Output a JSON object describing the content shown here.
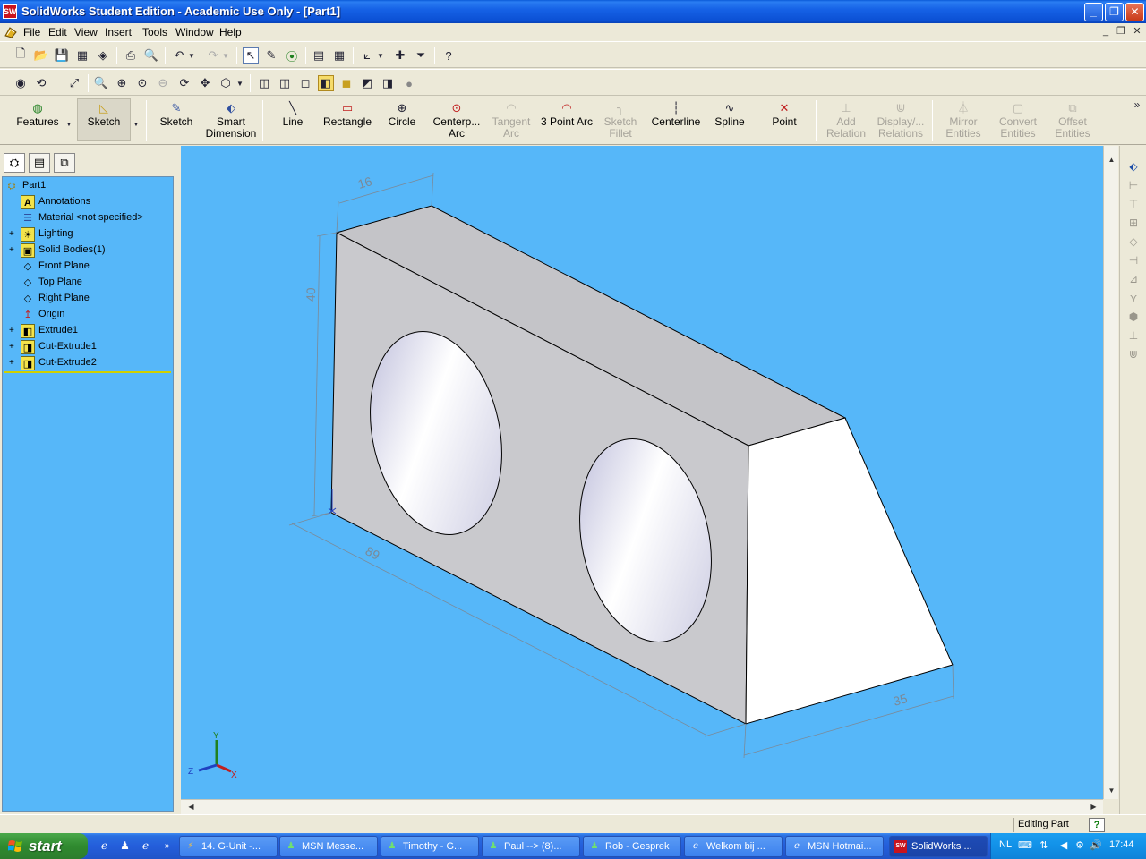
{
  "window": {
    "title": "SolidWorks Student Edition - Academic Use Only - [Part1]",
    "app_icon_text": "SW",
    "caption_buttons": [
      "_",
      "❐",
      "✕"
    ]
  },
  "menubar": {
    "items": [
      "File",
      "Edit",
      "View",
      "Insert",
      "Tools",
      "Window",
      "Help"
    ]
  },
  "command_manager": {
    "tabs": [
      "Features",
      "Sketch"
    ],
    "active_tab": "Sketch",
    "commands": [
      {
        "label1": "Sketch",
        "label2": "",
        "enabled": true
      },
      {
        "label1": "Smart",
        "label2": "Dimension",
        "enabled": true
      },
      {
        "label1": "Line",
        "label2": "",
        "enabled": true
      },
      {
        "label1": "Rectangle",
        "label2": "",
        "enabled": true
      },
      {
        "label1": "Circle",
        "label2": "",
        "enabled": true
      },
      {
        "label1": "Centerp...",
        "label2": "Arc",
        "enabled": true
      },
      {
        "label1": "Tangent",
        "label2": "Arc",
        "enabled": false
      },
      {
        "label1": "3 Point Arc",
        "label2": "",
        "enabled": true
      },
      {
        "label1": "Sketch",
        "label2": "Fillet",
        "enabled": false
      },
      {
        "label1": "Centerline",
        "label2": "",
        "enabled": true
      },
      {
        "label1": "Spline",
        "label2": "",
        "enabled": true
      },
      {
        "label1": "Point",
        "label2": "",
        "enabled": true
      },
      {
        "label1": "Add",
        "label2": "Relation",
        "enabled": false
      },
      {
        "label1": "Display/...",
        "label2": "Relations",
        "enabled": false
      },
      {
        "label1": "Mirror",
        "label2": "Entities",
        "enabled": false
      },
      {
        "label1": "Convert",
        "label2": "Entities",
        "enabled": false
      },
      {
        "label1": "Offset",
        "label2": "Entities",
        "enabled": false
      }
    ],
    "overflow": "»"
  },
  "feature_tree": {
    "items": [
      {
        "label": "Part1",
        "expandable": false,
        "icon": "part-icon"
      },
      {
        "label": "Annotations",
        "expandable": false,
        "icon": "annotations-icon"
      },
      {
        "label": "Material <not specified>",
        "expandable": false,
        "icon": "material-icon"
      },
      {
        "label": "Lighting",
        "expandable": true,
        "icon": "lighting-icon"
      },
      {
        "label": "Solid Bodies(1)",
        "expandable": true,
        "icon": "solid-bodies-icon"
      },
      {
        "label": "Front Plane",
        "expandable": false,
        "icon": "plane-icon"
      },
      {
        "label": "Top Plane",
        "expandable": false,
        "icon": "plane-icon"
      },
      {
        "label": "Right Plane",
        "expandable": false,
        "icon": "plane-icon"
      },
      {
        "label": "Origin",
        "expandable": false,
        "icon": "origin-icon"
      },
      {
        "label": "Extrude1",
        "expandable": true,
        "icon": "extrude-icon"
      },
      {
        "label": "Cut-Extrude1",
        "expandable": true,
        "icon": "cut-extrude-icon"
      },
      {
        "label": "Cut-Extrude2",
        "expandable": true,
        "icon": "cut-extrude-icon"
      }
    ]
  },
  "model": {
    "dimensions": {
      "top": "16",
      "left": "40",
      "bottom": "89",
      "right": "35"
    },
    "triad": {
      "x": "X",
      "y": "Y",
      "z": "Z"
    },
    "colors": {
      "background": "#56b7f9",
      "face": "#c8c8cc",
      "top_face": "#c4c4c8",
      "side_face": "#ffffff",
      "dimension": "#7a8a99"
    }
  },
  "status": {
    "mode": "Editing Part",
    "help": "?"
  },
  "taskbar": {
    "start_label": "start",
    "tasks": [
      {
        "label": "14. G-Unit -...",
        "active": false
      },
      {
        "label": "MSN Messe...",
        "active": false
      },
      {
        "label": "Timothy - G...",
        "active": false
      },
      {
        "label": "Paul --> (8)...",
        "active": false
      },
      {
        "label": "Rob - Gesprek",
        "active": false
      },
      {
        "label": "Welkom bij ...",
        "active": false
      },
      {
        "label": "MSN Hotmai...",
        "active": false
      },
      {
        "label": "SolidWorks ...",
        "active": true
      }
    ],
    "tray_language": "NL",
    "clock": "17:44"
  }
}
